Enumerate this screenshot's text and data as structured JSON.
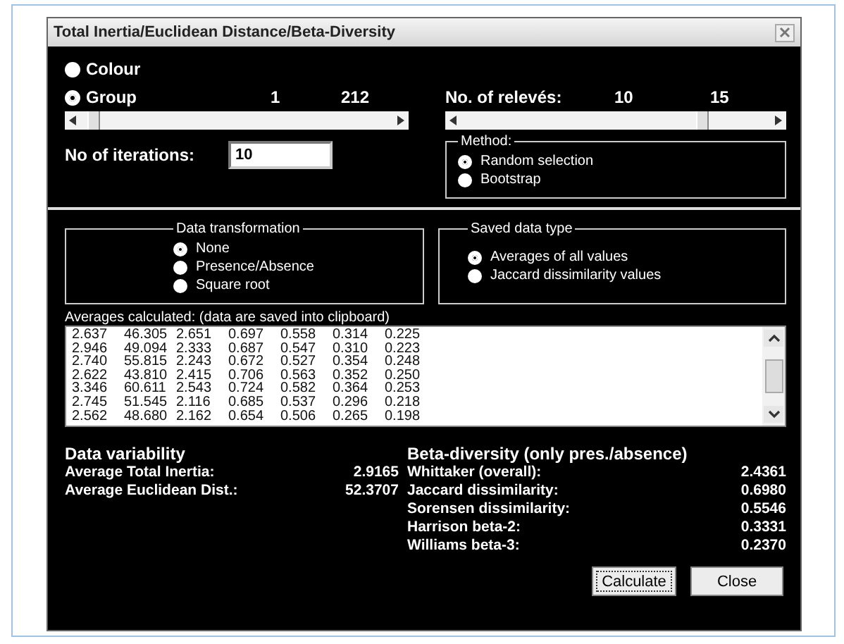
{
  "window": {
    "title": "Total Inertia/Euclidean Distance/Beta-Diversity"
  },
  "display_options": [
    {
      "label": "Colour",
      "selected": false
    },
    {
      "label": "Group",
      "selected": true
    }
  ],
  "group_slider": {
    "min_label": "1",
    "max_label": "212",
    "level": 0.02
  },
  "releves_slider": {
    "label": "No. of relevés:",
    "min_label": "10",
    "max_label": "15",
    "level": 0.76
  },
  "iterations": {
    "label": "No of iterations:",
    "value": "10"
  },
  "method": {
    "title": "Method:",
    "options": [
      {
        "label": "Random selection",
        "selected": true
      },
      {
        "label": "Bootstrap",
        "selected": false
      }
    ]
  },
  "data_transformation": {
    "title": "Data transformation",
    "options": [
      {
        "label": "None",
        "selected": true
      },
      {
        "label": "Presence/Absence",
        "selected": false
      },
      {
        "label": "Square root",
        "selected": false
      }
    ]
  },
  "saved_data_type": {
    "title": "Saved data type",
    "options": [
      {
        "label": "Averages of all values",
        "selected": true
      },
      {
        "label": "Jaccard dissimilarity values",
        "selected": false
      }
    ]
  },
  "averages": {
    "label": "Averages calculated: (data are saved into clipboard)",
    "rows": [
      [
        "2.637",
        "46.305",
        "2.651",
        "0.697",
        "0.558",
        "0.314",
        "0.225"
      ],
      [
        "2.946",
        "49.094",
        "2.333",
        "0.687",
        "0.547",
        "0.310",
        "0.223"
      ],
      [
        "2.740",
        "55.815",
        "2.243",
        "0.672",
        "0.527",
        "0.354",
        "0.248"
      ],
      [
        "2.622",
        "43.810",
        "2.415",
        "0.706",
        "0.563",
        "0.352",
        "0.250"
      ],
      [
        "3.346",
        "60.611",
        "2.543",
        "0.724",
        "0.582",
        "0.364",
        "0.253"
      ],
      [
        "2.745",
        "51.545",
        "2.116",
        "0.685",
        "0.537",
        "0.296",
        "0.218"
      ],
      [
        "2.562",
        "48.680",
        "2.162",
        "0.654",
        "0.506",
        "0.265",
        "0.198"
      ]
    ]
  },
  "data_variability": {
    "title": "Data variability",
    "items": [
      {
        "label": "Average Total Inertia:",
        "value": "2.9165"
      },
      {
        "label": "Average Euclidean Dist.:",
        "value": "52.3707"
      }
    ]
  },
  "beta_diversity": {
    "title": "Beta-diversity (only pres./absence)",
    "items": [
      {
        "label": "Whittaker (overall):",
        "value": "2.4361"
      },
      {
        "label": "Jaccard dissimilarity:",
        "value": "0.6980"
      },
      {
        "label": "Sorensen dissimilarity:",
        "value": "0.5546"
      },
      {
        "label": "Harrison beta-2:",
        "value": "0.3331"
      },
      {
        "label": "Williams beta-3:",
        "value": "0.2370"
      }
    ]
  },
  "buttons": [
    {
      "label": "Calculate",
      "focused": true
    },
    {
      "label": "Close",
      "focused": false
    }
  ]
}
